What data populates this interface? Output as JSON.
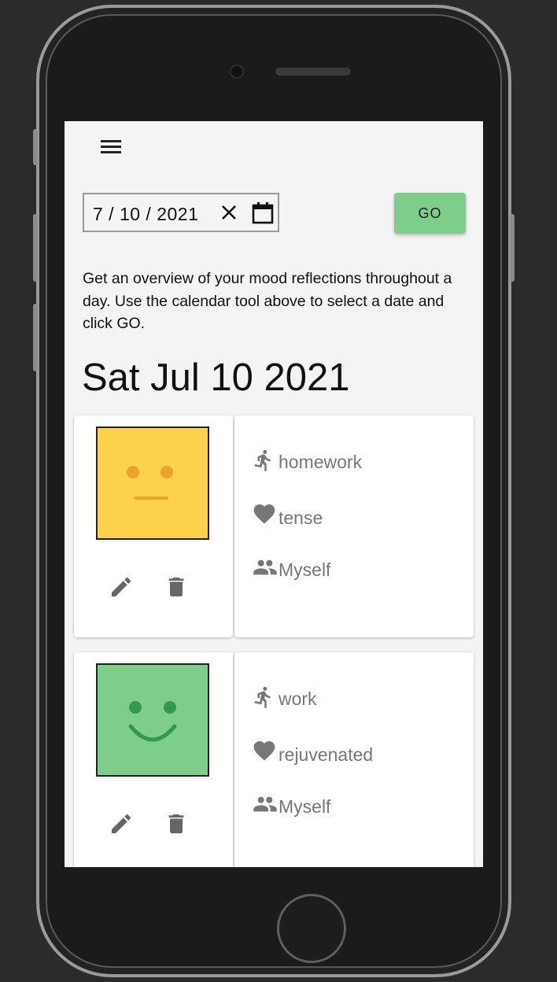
{
  "date_picker": {
    "value": "7 / 10 / 2021",
    "go_label": "GO"
  },
  "intro_text": "Get an overview of your mood reflections throughout a day. Use the calendar tool above to select a date and click GO.",
  "date_heading": "Sat Jul 10 2021",
  "entries": [
    {
      "mood": "neutral-face",
      "mood_color": "#fcd14c",
      "face_feature_color": "#e8a42c",
      "activity": "homework",
      "feeling": "tense",
      "company": "Myself"
    },
    {
      "mood": "happy-face",
      "mood_color": "#7fcd8a",
      "face_feature_color": "#2e9a4a",
      "activity": "work",
      "feeling": "rejuvenated",
      "company": "Myself"
    }
  ],
  "icons": {
    "menu": "hamburger-menu-icon",
    "clear": "close-icon",
    "calendar": "calendar-icon",
    "edit": "pencil-icon",
    "delete": "trash-icon",
    "activity": "running-person-icon",
    "feeling": "heart-icon",
    "company": "people-icon"
  }
}
